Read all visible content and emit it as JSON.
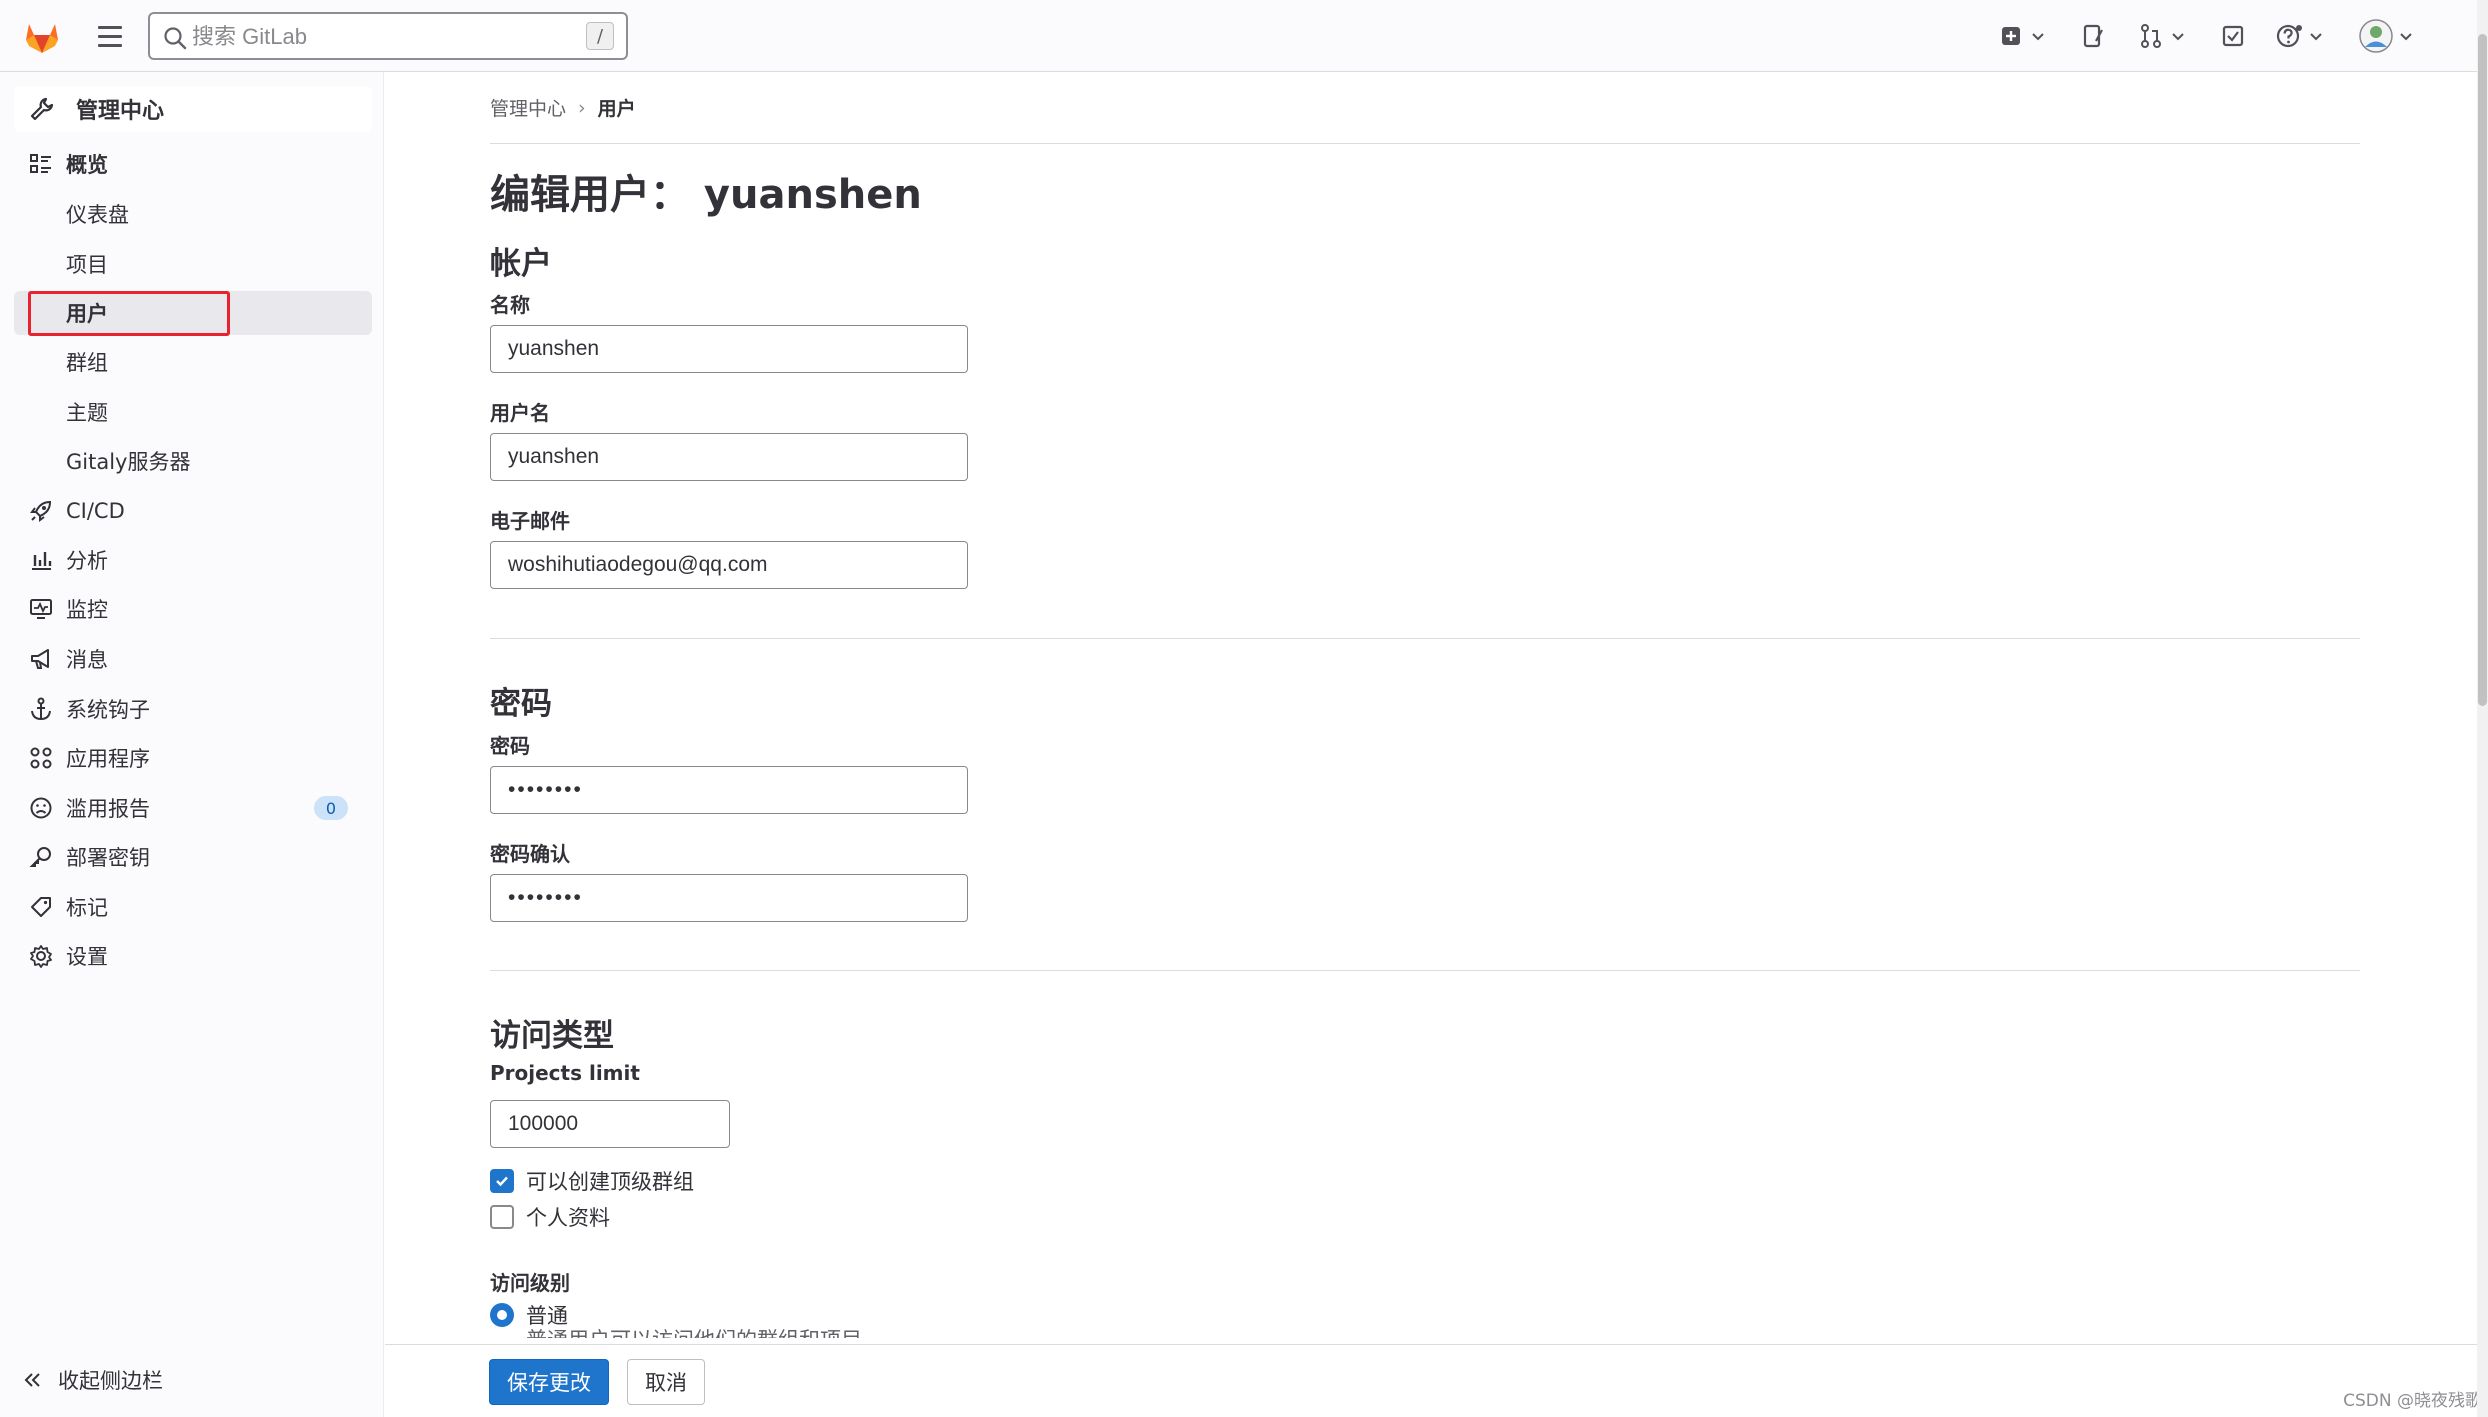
{
  "topbar": {
    "search_placeholder": "搜索 GitLab",
    "search_shortcut": "/",
    "icons": [
      "create-new-icon",
      "issues-icon",
      "merge-requests-icon",
      "todos-icon",
      "help-icon",
      "avatar-icon"
    ]
  },
  "sidebar": {
    "header": "管理中心",
    "overview": "概览",
    "items": {
      "dashboard": "仪表盘",
      "projects": "项目",
      "users": "用户",
      "groups": "群组",
      "topics": "主题",
      "gitaly": "Gitaly服务器",
      "cicd": "CI/CD",
      "analytics": "分析",
      "monitoring": "监控",
      "messages": "消息",
      "hooks": "系统钩子",
      "applications": "应用程序",
      "abuse": "滥用报告",
      "abuse_count": "0",
      "deploy_keys": "部署密钥",
      "labels": "标记",
      "settings": "设置"
    },
    "collapse": "收起侧边栏"
  },
  "breadcrumb": {
    "root": "管理中心",
    "sep": "›",
    "current": "用户"
  },
  "page": {
    "title": "编辑用户： yuanshen"
  },
  "account": {
    "heading": "帐户",
    "name_label": "名称",
    "name_value": "yuanshen",
    "username_label": "用户名",
    "username_value": "yuanshen",
    "email_label": "电子邮件",
    "email_value": "woshihutiaodegou@qq.com"
  },
  "password": {
    "heading": "密码",
    "pw_label": "密码",
    "pw_value": "••••••••",
    "confirm_label": "密码确认",
    "confirm_value": "••••••••"
  },
  "access": {
    "heading": "访问类型",
    "projects_limit_label": "Projects limit",
    "projects_limit_value": "100000",
    "can_create_group": "可以创建顶级群组",
    "can_create_group_checked": true,
    "private_profile": "个人资料",
    "private_profile_checked": false,
    "level_label": "访问级别",
    "level_regular": "普通",
    "level_regular_desc": "普通用户可以访问他们的群组和项目"
  },
  "actions": {
    "save": "保存更改",
    "cancel": "取消"
  },
  "watermark": "CSDN @晓夜残歌"
}
